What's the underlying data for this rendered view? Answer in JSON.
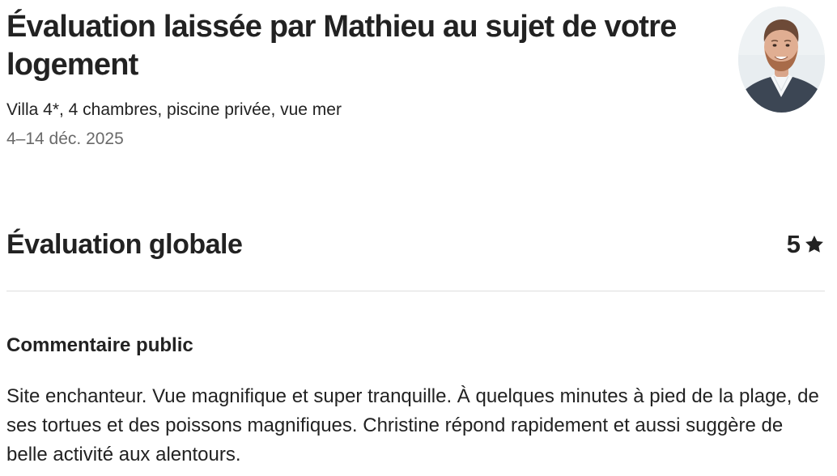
{
  "header": {
    "title": "Évaluation laissée par Mathieu au sujet de votre logement",
    "listing_name": "Villa 4*, 4 chambres, piscine privée, vue mer",
    "dates": "4–14 déc. 2025"
  },
  "reviewer": {
    "avatar_icon": "reviewer-avatar-photo"
  },
  "overall": {
    "title": "Évaluation globale",
    "rating": "5",
    "rating_icon": "star-icon"
  },
  "public_comment": {
    "heading": "Commentaire public",
    "text": "Site enchanteur. Vue magnifique et super tranquille. À quelques minutes à pied de la plage, de ses tortues et des poissons magnifiques. Christine répond rapidement et aussi suggère de belle activité aux alentours."
  }
}
